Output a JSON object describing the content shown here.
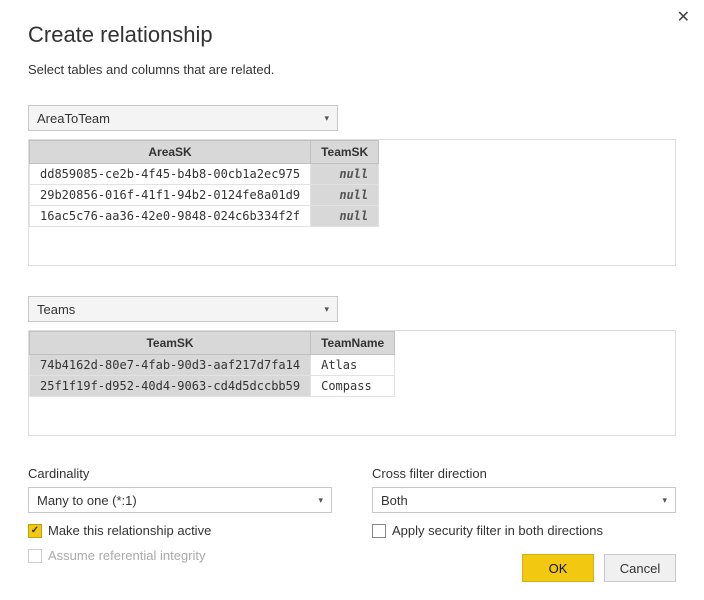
{
  "dialog": {
    "title": "Create relationship",
    "subtitle": "Select tables and columns that are related."
  },
  "table1": {
    "selected": "AreaToTeam",
    "columns": [
      "AreaSK",
      "TeamSK"
    ],
    "rows": [
      {
        "AreaSK": "dd859085-ce2b-4f45-b4b8-00cb1a2ec975",
        "TeamSK": "null"
      },
      {
        "AreaSK": "29b20856-016f-41f1-94b2-0124fe8a01d9",
        "TeamSK": "null"
      },
      {
        "AreaSK": "16ac5c76-aa36-42e0-9848-024c6b334f2f",
        "TeamSK": "null"
      }
    ]
  },
  "table2": {
    "selected": "Teams",
    "columns": [
      "TeamSK",
      "TeamName"
    ],
    "rows": [
      {
        "TeamSK": "74b4162d-80e7-4fab-90d3-aaf217d7fa14",
        "TeamName": "Atlas"
      },
      {
        "TeamSK": "25f1f19f-d952-40d4-9063-cd4d5dccbb59",
        "TeamName": "Compass"
      }
    ]
  },
  "cardinality": {
    "label": "Cardinality",
    "value": "Many to one (*:1)"
  },
  "cross_filter": {
    "label": "Cross filter direction",
    "value": "Both"
  },
  "checkboxes": {
    "active_label": "Make this relationship active",
    "security_label": "Apply security filter in both directions",
    "referential_label": "Assume referential integrity"
  },
  "footer": {
    "ok": "OK",
    "cancel": "Cancel"
  }
}
